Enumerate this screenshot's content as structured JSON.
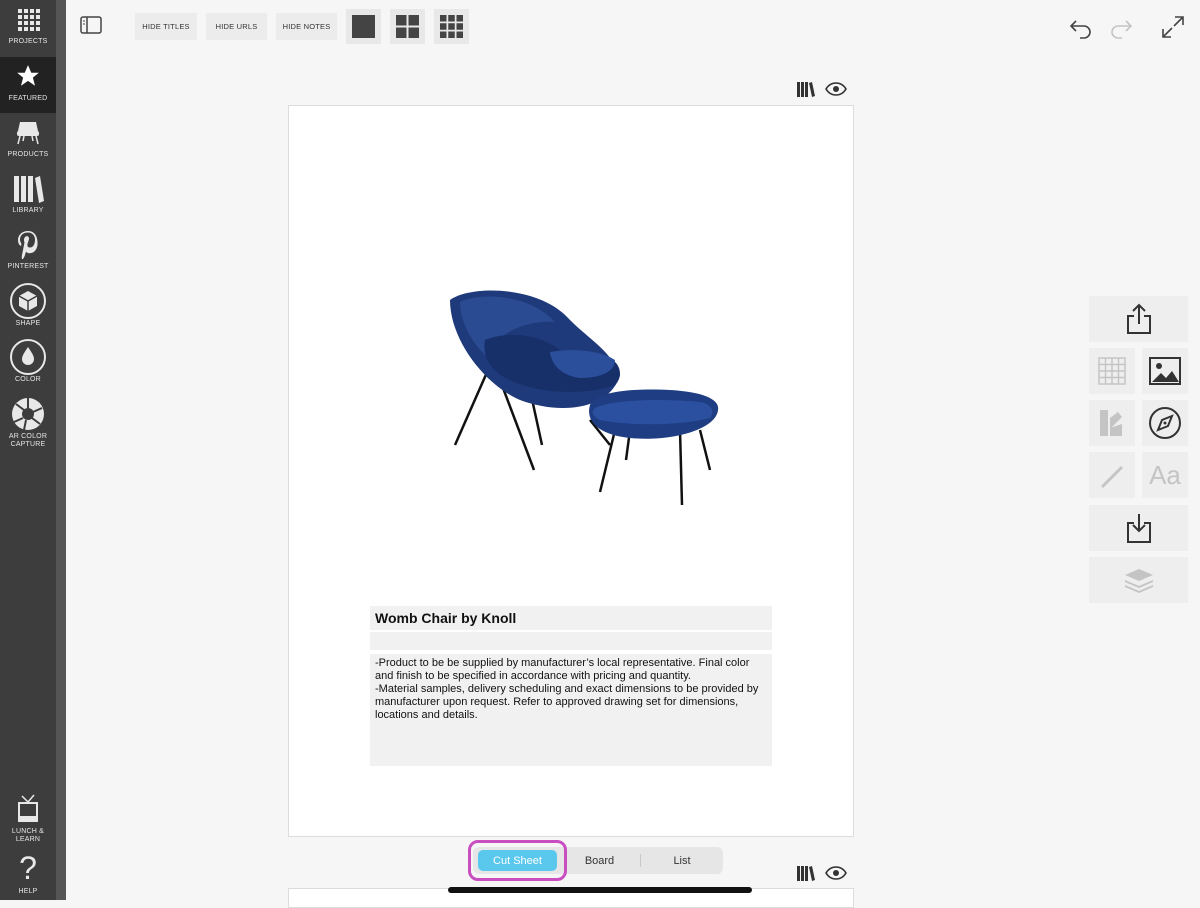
{
  "sidebar": {
    "items": [
      {
        "label": "PROJECTS",
        "icon": "projects-grid-icon"
      },
      {
        "label": "FEATURED",
        "icon": "star-icon"
      },
      {
        "label": "PRODUCTS",
        "icon": "chair-icon"
      },
      {
        "label": "LIBRARY",
        "icon": "books-icon"
      },
      {
        "label": "PINTEREST",
        "icon": "pinterest-icon"
      },
      {
        "label": "SHAPE",
        "icon": "cube-icon"
      },
      {
        "label": "COLOR",
        "icon": "drop-icon"
      },
      {
        "label": "AR COLOR CAPTURE",
        "icon": "aperture-icon"
      },
      {
        "label": "LUNCH & LEARN",
        "icon": "tv-icon"
      },
      {
        "label": "HELP",
        "icon": "question-icon"
      }
    ]
  },
  "toolbar": {
    "hide_titles": "HIDE TITLES",
    "hide_urls": "HIDE URLS",
    "hide_notes": "HIDE NOTES"
  },
  "product": {
    "title": "Womb Chair by Knoll",
    "url": "",
    "notes": "-Product to be be supplied by manufacturer’s local representative. Final color\nand finish to be specified in accordance with pricing and quantity.\n-Material samples, delivery scheduling and exact dimensions to be provided by\nmanufacturer upon request. Refer to approved drawing set for dimensions,\nlocations and details."
  },
  "view_modes": {
    "cut_sheet": "Cut Sheet",
    "board": "Board",
    "list": "List",
    "selected": "Cut Sheet"
  },
  "colors": {
    "sidebar": "#3d3d3d",
    "active_segment": "#5ac8ed",
    "highlight": "#c94fc0",
    "chair": "#1f3a7a"
  }
}
